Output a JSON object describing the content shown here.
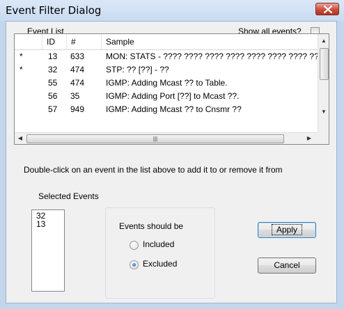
{
  "window": {
    "title": "Event Filter Dialog"
  },
  "event_list": {
    "label": "Event List",
    "show_all_label": "Show all events?",
    "show_all_checked": false,
    "columns": [
      "ID",
      "#",
      "Sample"
    ],
    "rows": [
      {
        "mark": "*",
        "id": "13",
        "count": "633",
        "sample": "MON: STATS - ???? ???? ???? ???? ???? ???? ???? ????"
      },
      {
        "mark": "*",
        "id": "32",
        "count": "474",
        "sample": "STP: ?? [??] - ??"
      },
      {
        "mark": "",
        "id": "55",
        "count": "474",
        "sample": "IGMP: Adding Mcast ?? to Table."
      },
      {
        "mark": "",
        "id": "56",
        "count": "35",
        "sample": "IGMP: Adding Port [??] to Mcast ??."
      },
      {
        "mark": "",
        "id": "57",
        "count": "949",
        "sample": "IGMP: Adding Mcast ?? to Cnsmr ??"
      }
    ]
  },
  "instruction": "Double-click on an event in the list above to add it to or remove it from",
  "selected_events": {
    "label": "Selected Events",
    "items": [
      "32",
      "13"
    ]
  },
  "mode": {
    "label": "Events should be",
    "options": [
      {
        "label": "Included",
        "selected": false
      },
      {
        "label": "Excluded",
        "selected": true
      }
    ]
  },
  "buttons": {
    "apply": "Apply",
    "cancel": "Cancel"
  },
  "icons": {
    "close": "close-icon",
    "scroll_up": "scroll-up-arrow-icon",
    "scroll_down": "scroll-down-arrow-icon",
    "scroll_left": "scroll-left-arrow-icon",
    "scroll_right": "scroll-right-arrow-icon"
  },
  "colors": {
    "title_bar": "#c9dbf1",
    "close_button": "#cc4b3a",
    "dialog_bg": "#f0f0f0"
  }
}
